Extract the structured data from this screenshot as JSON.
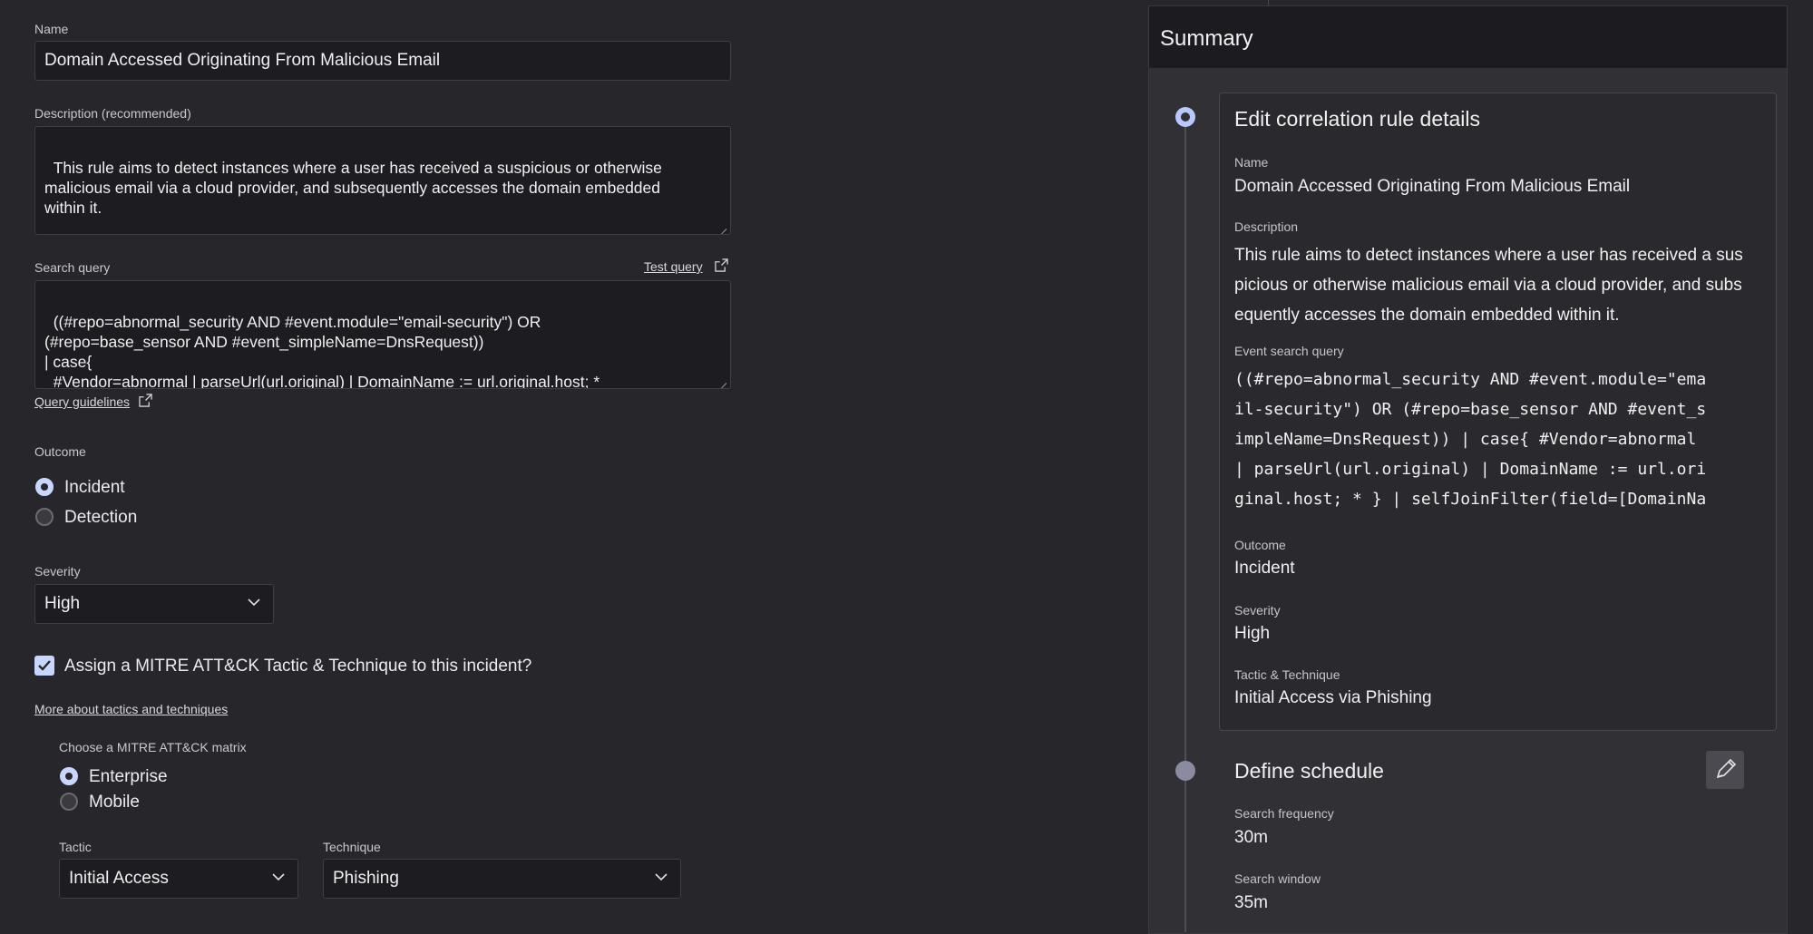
{
  "form": {
    "name": {
      "label": "Name",
      "value": "Domain Accessed Originating From Malicious Email"
    },
    "description": {
      "label": "Description (recommended)",
      "value": "This rule aims to detect instances where a user has received a suspicious or otherwise\nmalicious email via a cloud provider, and subsequently accesses the domain embedded\nwithin it."
    },
    "search_query": {
      "label": "Search query",
      "test_link": "Test query",
      "value": "((#repo=abnormal_security AND #event.module=\"email-security\") OR\n(#repo=base_sensor AND #event_simpleName=DnsRequest))\n| case{\n  #Vendor=abnormal | parseUrl(url.original) | DomainName := url.original.host; *\n}",
      "guidelines_link": "Query guidelines"
    },
    "outcome": {
      "label": "Outcome",
      "options": [
        "Incident",
        "Detection"
      ],
      "selected": "Incident"
    },
    "severity": {
      "label": "Severity",
      "value": "High"
    },
    "mitre_checkbox": {
      "label": "Assign a MITRE ATT&CK Tactic & Technique to this incident?",
      "checked": true
    },
    "mitre_link": "More about tactics and techniques",
    "matrix": {
      "label": "Choose a MITRE ATT&CK matrix",
      "options": [
        "Enterprise",
        "Mobile"
      ],
      "selected": "Enterprise"
    },
    "tactic": {
      "label": "Tactic",
      "value": "Initial Access"
    },
    "technique": {
      "label": "Technique",
      "value": "Phishing"
    }
  },
  "summary": {
    "title": "Summary",
    "step1": {
      "title": "Edit correlation rule details",
      "name_label": "Name",
      "name_value": "Domain Accessed Originating From Malicious Email",
      "description_label": "Description",
      "description_value": "This rule aims to detect instances where a user has received a sus\npicious or otherwise malicious email via a cloud provider, and subs\nequently accesses the domain embedded within it.",
      "query_label": "Event search query",
      "query_value": "((#repo=abnormal_security AND #event.module=\"ema\nil-security\") OR (#repo=base_sensor AND #event_s\nimpleName=DnsRequest)) | case{ #Vendor=abnormal\n| parseUrl(url.original) | DomainName := url.ori\nginal.host; * } | selfJoinFilter(field=[DomainNa\nme], where=[{#event.module=\"email-security\"},",
      "outcome_label": "Outcome",
      "outcome_value": "Incident",
      "severity_label": "Severity",
      "severity_value": "High",
      "tactic_label": "Tactic & Technique",
      "tactic_value": "Initial Access via Phishing"
    },
    "step2": {
      "title": "Define schedule",
      "freq_label": "Search frequency",
      "freq_value": "30m",
      "window_label": "Search window",
      "window_value": "35m"
    }
  },
  "colors": {
    "background": "#27272b",
    "accent": "#c9d7ff",
    "field": "#1d1d21"
  }
}
